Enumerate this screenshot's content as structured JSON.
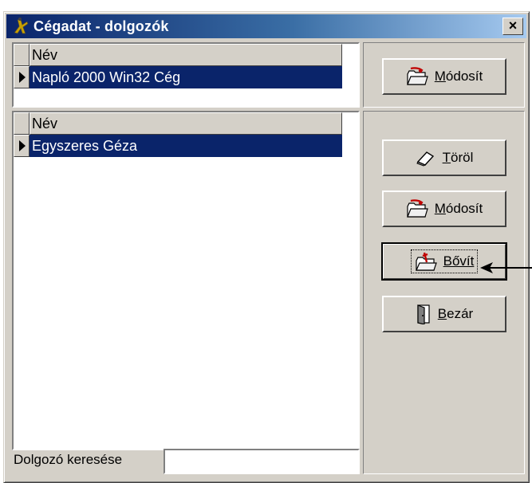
{
  "window": {
    "title": "Cégadat - dolgozók",
    "close_label": "×"
  },
  "company_grid": {
    "column_header": "Név",
    "rows": [
      "Napló 2000 Win32 Cég"
    ]
  },
  "company_buttons": {
    "modify_label": "Módosít"
  },
  "employee_grid": {
    "column_header": "Név",
    "rows": [
      "Egyszeres Géza"
    ]
  },
  "employee_buttons": {
    "delete_label": "Töröl",
    "modify_label": "Módosít",
    "expand_label": "Bővít",
    "close_label": "Bezár"
  },
  "search": {
    "label": "Dolgozó keresése",
    "value": ""
  },
  "icons": {
    "window_icon": "figure-icon",
    "modify_icon": "folder-edit-icon",
    "delete_icon": "eraser-icon",
    "expand_icon": "folder-add-icon",
    "close_icon": "door-icon",
    "pointer_arrow": "arrow-left-icon"
  },
  "colors": {
    "titlebar_start": "#0a246a",
    "titlebar_end": "#a6caf0",
    "selection": "#0a246a",
    "face": "#d4d0c8"
  }
}
